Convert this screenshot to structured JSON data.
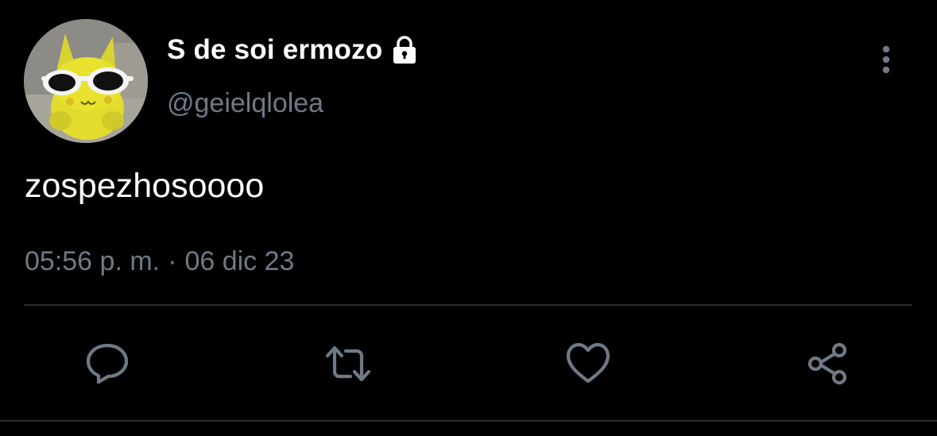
{
  "tweet": {
    "display_name": "S de soi ermozo",
    "handle": "@geielqlolea",
    "text": "zospezhosoooo",
    "time": "05:56 p. m.",
    "separator": "·",
    "date": "06 dic 23",
    "protected": true
  },
  "icons": {
    "lock": "lock-icon",
    "more": "more-vertical-icon",
    "reply": "reply-icon",
    "retweet": "retweet-icon",
    "like": "heart-icon",
    "share": "share-icon"
  },
  "colors": {
    "background": "#000000",
    "primary_text": "#ffffff",
    "secondary_text": "#6e7a86",
    "divider": "#2a2d31"
  }
}
